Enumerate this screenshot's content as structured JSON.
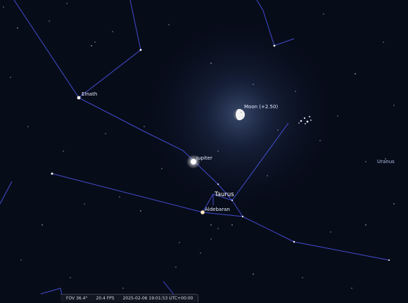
{
  "labels": {
    "elnath": "Elnath",
    "moon": "Moon (+2.50)",
    "jupiter": "Jupiter",
    "taurus": "Taurus",
    "aldebaran": "Aldebaran",
    "uranus": "Uranus"
  },
  "status": {
    "fov": "FOV 36.4°",
    "fps": "20.4 FPS",
    "datetime": "2025-02-06 19:01:53 UTC+00:00"
  }
}
